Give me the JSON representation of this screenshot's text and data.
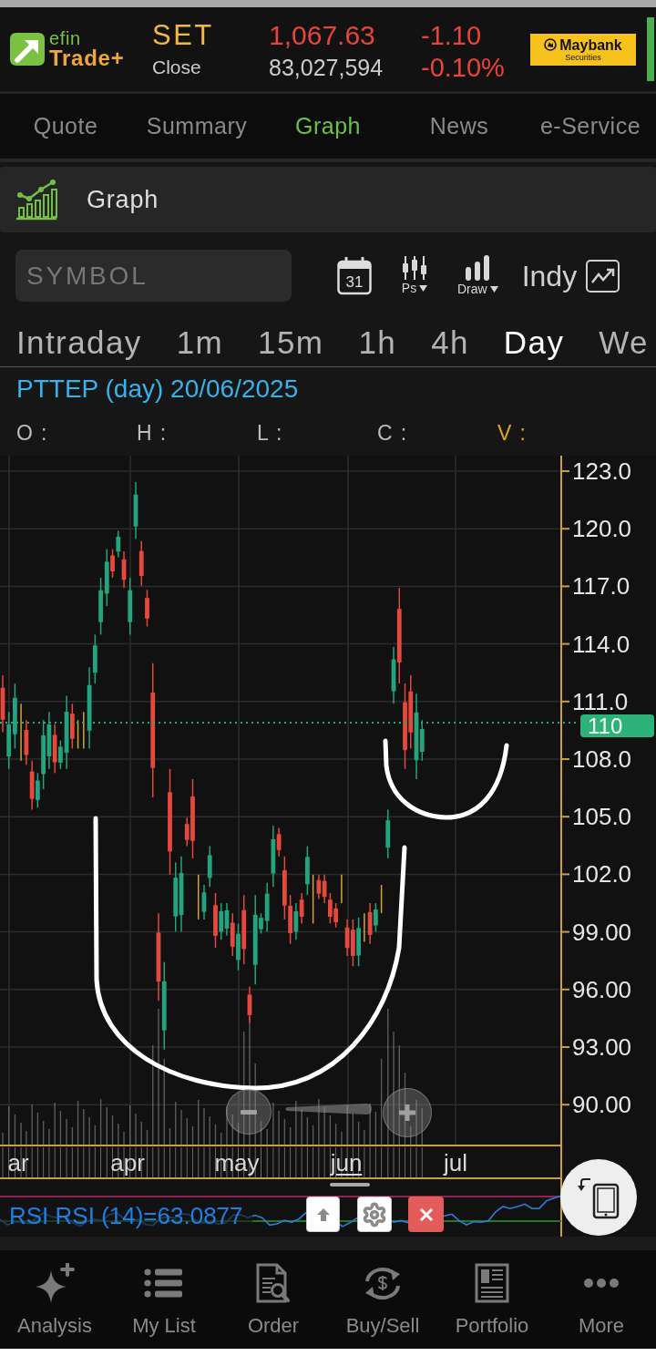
{
  "header": {
    "app_logo": {
      "line_1": "efin",
      "line_2": "Trade+"
    },
    "market": {
      "index": "SET",
      "session": "Close",
      "value": "1,067.63",
      "volume": "83,027,594",
      "change": "-1.10",
      "change_percent": "-0.10%"
    },
    "broker_logo": {
      "name": "Maybank",
      "tagline": "Securities"
    }
  },
  "tabs": [
    {
      "label": "Quote",
      "selected": false
    },
    {
      "label": "Summary",
      "selected": false
    },
    {
      "label": "Graph",
      "selected": true
    },
    {
      "label": "News",
      "selected": false
    },
    {
      "label": "e-Service",
      "selected": false
    }
  ],
  "section": {
    "title": "Graph"
  },
  "toolbar": {
    "symbol_field": {
      "placeholder": "SYMBOL"
    },
    "calendar": {
      "day": "31"
    },
    "price_style": {
      "label": "Ps"
    },
    "draw": {
      "label": "Draw"
    },
    "indicator": {
      "label": "Indy"
    }
  },
  "intervals": [
    {
      "label": "Intraday",
      "selected": false
    },
    {
      "label": "1m",
      "selected": false
    },
    {
      "label": "15m",
      "selected": false
    },
    {
      "label": "1h",
      "selected": false
    },
    {
      "label": "4h",
      "selected": false
    },
    {
      "label": "Day",
      "selected": true
    },
    {
      "label": "We",
      "selected": false
    }
  ],
  "chart": {
    "title": "PTTEP (day) 20/06/2025",
    "readouts": [
      {
        "label": "O :",
        "kind": "price"
      },
      {
        "label": "H :",
        "kind": "price"
      },
      {
        "label": "L :",
        "kind": "price"
      },
      {
        "label": "C :",
        "kind": "price"
      },
      {
        "label": "V :",
        "kind": "volume"
      }
    ],
    "price_labels": [
      "123.0",
      "120.0",
      "117.0",
      "114.0",
      "111.0",
      "108.0",
      "105.0",
      "102.0",
      "99.00",
      "96.00",
      "93.00",
      "90.00"
    ],
    "last_price": "110",
    "month_labels": [
      {
        "label": "ar",
        "underlined": false
      },
      {
        "label": "apr",
        "underlined": false
      },
      {
        "label": "may",
        "underlined": false
      },
      {
        "label": "jun",
        "underlined": true
      },
      {
        "label": "jul",
        "underlined": false
      }
    ]
  },
  "indicator_panel": {
    "readout": "RSI RSI (14)=63.0877"
  },
  "bottom_nav": [
    {
      "label": "Analysis",
      "selected": false
    },
    {
      "label": "My List",
      "selected": false
    },
    {
      "label": "Order",
      "selected": false
    },
    {
      "label": "Buy/Sell",
      "selected": false
    },
    {
      "label": "Portfolio",
      "selected": false
    },
    {
      "label": "More",
      "selected": false
    }
  ]
}
